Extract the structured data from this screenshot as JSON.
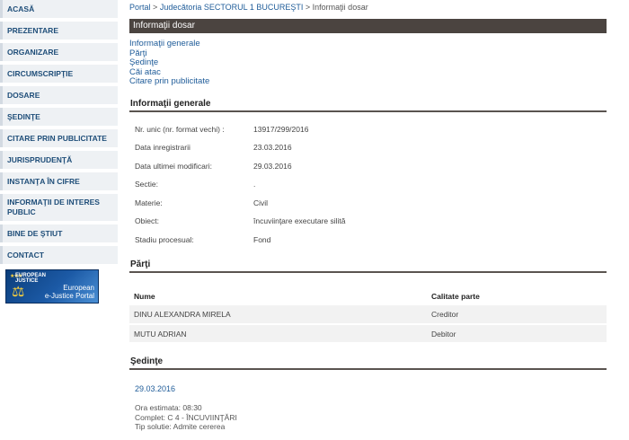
{
  "sidebar": {
    "items": [
      {
        "label": "ACASĂ"
      },
      {
        "label": "PREZENTARE"
      },
      {
        "label": "ORGANIZARE"
      },
      {
        "label": "CIRCUMSCRIPŢIE"
      },
      {
        "label": "DOSARE"
      },
      {
        "label": "ŞEDINŢE"
      },
      {
        "label": "CITARE PRIN PUBLICITATE"
      },
      {
        "label": "JURISPRUDENŢĂ"
      },
      {
        "label": "INSTANŢA ÎN CIFRE"
      },
      {
        "label": "INFORMAŢII DE INTERES PUBLIC"
      },
      {
        "label": "BINE DE ŞTIUT"
      },
      {
        "label": "CONTACT"
      }
    ],
    "banner": {
      "line1": "EUROPEAN",
      "line2": "JUSTICE",
      "title_line1": "European",
      "title_line2": "e-Justice Portal"
    }
  },
  "breadcrumb": {
    "portal": "Portal",
    "court": "Judecătoria SECTORUL 1 BUCUREŞTI",
    "current": "Informaţii dosar",
    "separator": ">"
  },
  "page_title": "Informaţii dosar",
  "anchors": [
    "Informaţii generale",
    "Părţi",
    "Şedinţe",
    "Căi atac",
    "Citare prin publicitate"
  ],
  "general": {
    "title": "Informaţii generale",
    "rows": [
      {
        "label": "Nr. unic (nr. format vechi) :",
        "value": "13917/299/2016"
      },
      {
        "label": "Data inregistrarii",
        "value": "23.03.2016"
      },
      {
        "label": "Data ultimei modificari:",
        "value": "29.03.2016"
      },
      {
        "label": "Sectie:",
        "value": "."
      },
      {
        "label": "Materie:",
        "value": "Civil"
      },
      {
        "label": "Obiect:",
        "value": "încuviinţare executare silită"
      },
      {
        "label": "Stadiu procesual:",
        "value": "Fond"
      }
    ]
  },
  "parti": {
    "title": "Părţi",
    "headers": {
      "name": "Nume",
      "role": "Calitate parte"
    },
    "rows": [
      {
        "name": "DINU ALEXANDRA MIRELA",
        "role": "Creditor"
      },
      {
        "name": "MUTU ADRIAN",
        "role": "Debitor"
      }
    ]
  },
  "sedinte": {
    "title": "Şedinţe",
    "date": "29.03.2016",
    "ora": "Ora estimata: 08:30",
    "complet": "Complet: C 4 - ÎNCUVIINŢĂRI",
    "tip": "Tip solutie: Admite cererea"
  },
  "colors": {
    "nav_text": "#1f4e79",
    "link": "#1f5c99",
    "title_bar": "#4b4440"
  }
}
